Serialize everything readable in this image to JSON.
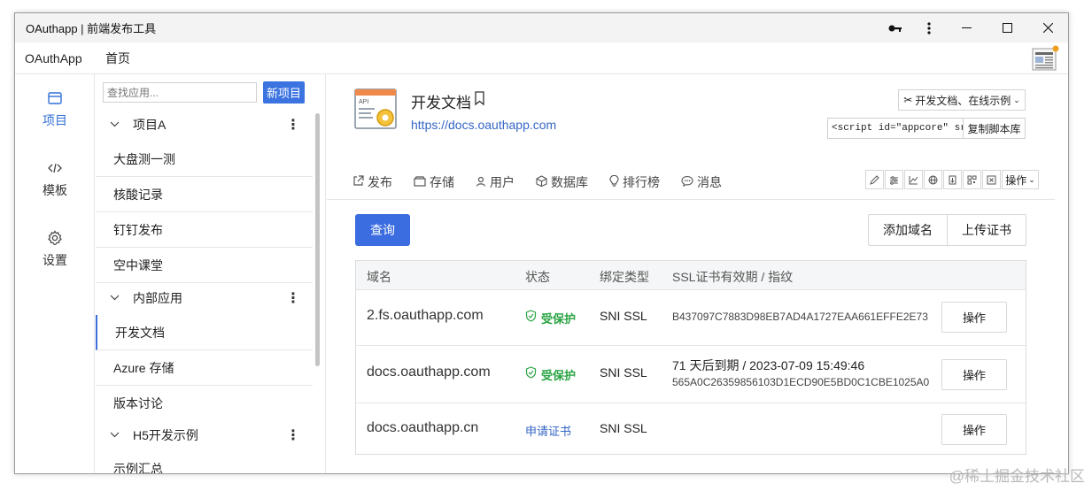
{
  "window": {
    "title": "OAuthapp | 前端发布工具"
  },
  "menubar": {
    "brand": "OAuthApp",
    "home": "首页"
  },
  "rail": [
    {
      "label": "项目",
      "icon": "window-icon",
      "active": true
    },
    {
      "label": "模板",
      "icon": "code-icon",
      "active": false
    },
    {
      "label": "设置",
      "icon": "gear-icon",
      "active": false
    }
  ],
  "projlist": {
    "search_placeholder": "查找应用...",
    "new_button": "新项目",
    "groups": [
      "项目A",
      "内部应用",
      "H5开发示例"
    ],
    "items": [
      "大盘测一测",
      "核酸记录",
      "钉钉发布",
      "空中课堂",
      "开发文档",
      "Azure 存储",
      "版本讨论",
      "示例汇总"
    ],
    "active_item": "开发文档"
  },
  "app": {
    "title": "开发文档",
    "url": "https://docs.oauthapp.com",
    "docs_button": "开发文档、在线示例",
    "script_value": "<script id=\"appcore\" src=\"h",
    "copy_button": "复制脚本库"
  },
  "tabs": [
    "发布",
    "存储",
    "用户",
    "数据库",
    "排行榜",
    "消息"
  ],
  "toolbar": {
    "op_label": "操作"
  },
  "actions": {
    "query": "查询",
    "add_domain": "添加域名",
    "upload_cert": "上传证书"
  },
  "table": {
    "headers": [
      "域名",
      "状态",
      "绑定类型",
      "SSL证书有效期 / 指纹"
    ],
    "rows": [
      {
        "domain": "2.fs.oauthapp.com",
        "status": "受保护",
        "type": "SNI SSL",
        "expiry": "",
        "fingerprint": "B437097C7883D98EB7AD4A1727EAA661EFFE2E73",
        "op": "操作"
      },
      {
        "domain": "docs.oauthapp.com",
        "status": "受保护",
        "type": "SNI SSL",
        "expiry": "71 天后到期 / 2023-07-09 15:49:46",
        "fingerprint": "565A0C26359856103D1ECD90E5BD0C1CBE1025A0",
        "op": "操作"
      },
      {
        "domain": "docs.oauthapp.cn",
        "status": "申请证书",
        "type": "SNI SSL",
        "expiry": "",
        "fingerprint": "",
        "op": "操作"
      }
    ]
  },
  "watermark": "@稀土掘金技术社区",
  "colors": {
    "accent": "#3b6de0",
    "ok": "#2aa443",
    "link": "#3566c4"
  }
}
